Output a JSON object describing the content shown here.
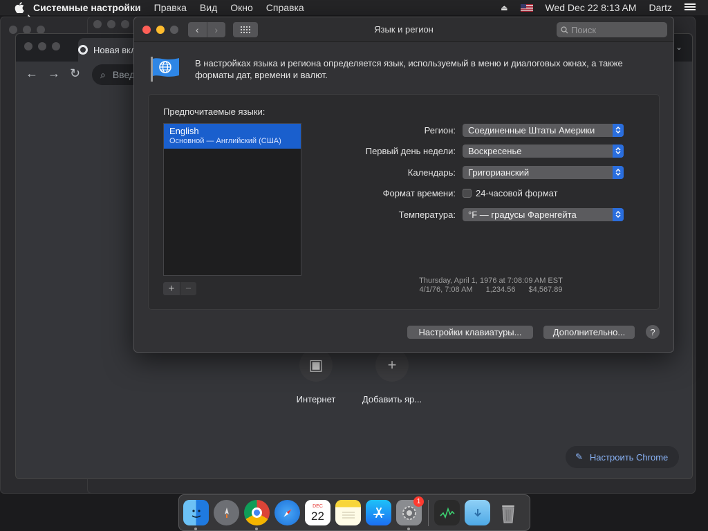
{
  "menubar": {
    "app_name": "Системные настройки",
    "items": [
      "Правка",
      "Вид",
      "Окно",
      "Справка"
    ],
    "clock": "Wed Dec 22  8:13 AM",
    "user": "Dartz"
  },
  "chrome": {
    "tab_title": "Новая вкл",
    "omnibox_placeholder": "Введ",
    "shortcuts": [
      {
        "label": "Интернет"
      },
      {
        "label": "Добавить яр..."
      }
    ],
    "customize_label": "Настроить Chrome"
  },
  "prefs": {
    "window_title": "Язык и регион",
    "search_placeholder": "Поиск",
    "intro": "В настройках языка и региона определяется язык, используемый в меню и диалоговых окнах, а также форматы дат, времени и валют.",
    "preferred_languages_label": "Предпочитаемые языки:",
    "languages": [
      {
        "name": "English",
        "detail": "Основной — Английский (США)"
      }
    ],
    "add_button": "+",
    "remove_button": "−",
    "region": {
      "label": "Регион:",
      "value": "Соединенные Штаты Америки"
    },
    "first_day": {
      "label": "Первый день недели:",
      "value": "Воскресенье"
    },
    "calendar": {
      "label": "Календарь:",
      "value": "Григорианский"
    },
    "time_format": {
      "label": "Формат времени:",
      "checkbox_label": "24-часовой формат",
      "checked": false
    },
    "temperature": {
      "label": "Температура:",
      "value": "°F — градусы Фаренгейта"
    },
    "sample": {
      "line1": "Thursday, April 1, 1976 at 7:08:09 AM EST",
      "date_short": "4/1/76, 7:08 AM",
      "number": "1,234.56",
      "currency": "$4,567.89"
    },
    "keyboard_button": "Настройки клавиатуры...",
    "advanced_button": "Дополнительно...",
    "help_button": "?"
  },
  "dock": {
    "calendar_month": "DEC",
    "calendar_day": "22",
    "sysprefs_badge": "1"
  },
  "colors": {
    "accent": "#2a6ede",
    "selection": "#1a5fcd",
    "close": "#fe5f57",
    "minimize": "#febc2e"
  }
}
